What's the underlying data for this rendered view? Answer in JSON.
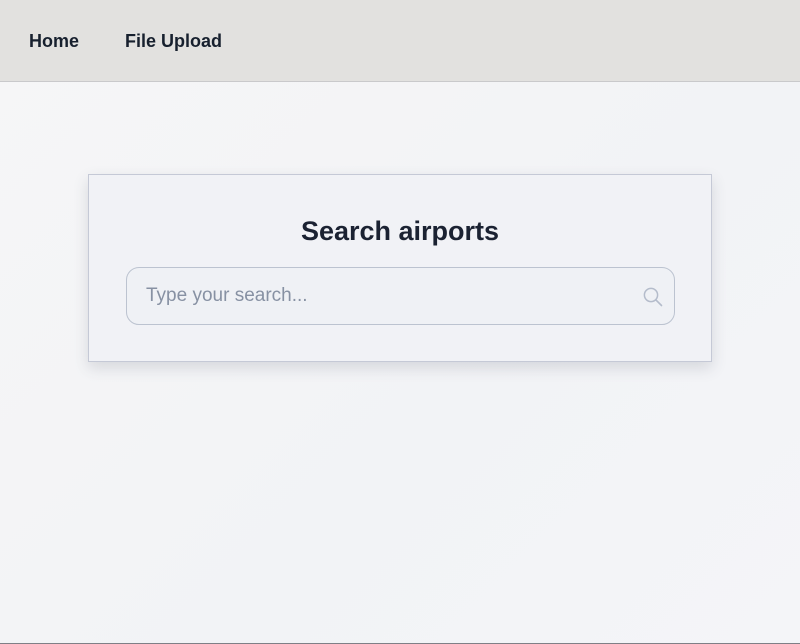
{
  "nav": {
    "items": [
      {
        "label": "Home"
      },
      {
        "label": "File Upload"
      }
    ]
  },
  "search_card": {
    "title": "Search airports",
    "input": {
      "value": "",
      "placeholder": "Type your search..."
    },
    "icon": "search-icon"
  },
  "colors": {
    "nav_background": "#e2e1df",
    "page_background": "#f3f4f7",
    "card_background": "#f1f2f6",
    "title_text": "#1b2232",
    "placeholder_text": "#8791a3",
    "input_border": "#bcc3d0"
  }
}
